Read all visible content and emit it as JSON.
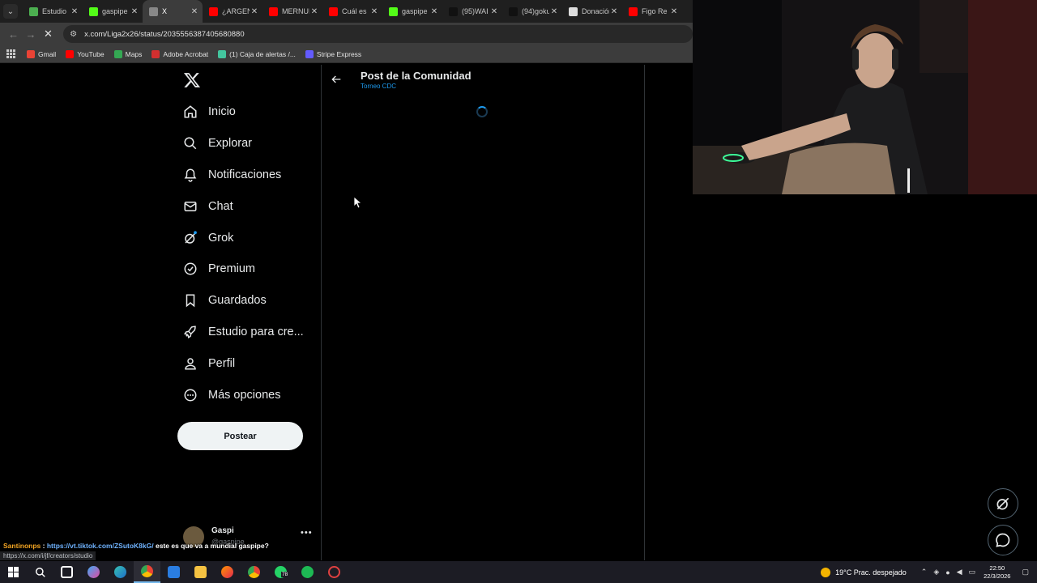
{
  "browser": {
    "tabs": [
      {
        "title": "Estudio",
        "fav_color": "#4caf50",
        "active": false
      },
      {
        "title": "gaspipe",
        "fav_color": "#53fc18",
        "active": false
      },
      {
        "title": "X",
        "fav_color": "#888888",
        "active": true
      },
      {
        "title": "¿ARGENTINA",
        "fav_color": "#ff0000",
        "active": false
      },
      {
        "title": "MERNUI",
        "fav_color": "#ff0000",
        "active": false
      },
      {
        "title": "Cuál es",
        "fav_color": "#ff0000",
        "active": false
      },
      {
        "title": "gaspipe",
        "fav_color": "#53fc18",
        "active": false
      },
      {
        "title": "(95)WAI",
        "fav_color": "#111111",
        "active": false
      },
      {
        "title": "(94)goku",
        "fav_color": "#111111",
        "active": false
      },
      {
        "title": "Donación",
        "fav_color": "#dddddd",
        "active": false
      },
      {
        "title": "Figo Re",
        "fav_color": "#ff0000",
        "active": false
      }
    ],
    "url": "x.com/Liga2x26/status/2035556387405680880",
    "bookmarks": [
      {
        "label": "Gmail",
        "color": "#ea4335"
      },
      {
        "label": "YouTube",
        "color": "#ff0000"
      },
      {
        "label": "Maps",
        "color": "#34a853"
      },
      {
        "label": "Adobe Acrobat",
        "color": "#d32f2f"
      },
      {
        "label": "(1) Caja de alertas /...",
        "color": "#43c59e"
      },
      {
        "label": "Stripe Express",
        "color": "#635bff"
      }
    ]
  },
  "x_app": {
    "nav": [
      {
        "label": "Inicio",
        "icon": "home-icon"
      },
      {
        "label": "Explorar",
        "icon": "search-icon"
      },
      {
        "label": "Notificaciones",
        "icon": "bell-icon"
      },
      {
        "label": "Chat",
        "icon": "mail-icon"
      },
      {
        "label": "Grok",
        "icon": "grok-icon"
      },
      {
        "label": "Premium",
        "icon": "premium-icon"
      },
      {
        "label": "Guardados",
        "icon": "bookmark-icon"
      },
      {
        "label": "Estudio para cre...",
        "icon": "rocket-icon"
      },
      {
        "label": "Perfil",
        "icon": "person-icon"
      },
      {
        "label": "Más opciones",
        "icon": "more-circle-icon"
      }
    ],
    "post_button": "Postear",
    "account": {
      "name": "Gaspi",
      "handle": "@gaspipe"
    },
    "main": {
      "title": "Post de la Comunidad",
      "subtitle": "Torneo CDC"
    },
    "accent": "#1d9bf0"
  },
  "chat": {
    "user": "Santinonps",
    "separator": " : ",
    "link": "https://vt.tiktok.com/ZSutoK8kG/",
    "message": " este es que va a mundial gaspipe?"
  },
  "status_bar_url": "https://x.com/i/jf/creators/studio",
  "taskbar": {
    "weather": "19°C  Prac. despejado",
    "time": "22:50",
    "date": "22/3/2026",
    "whatsapp_badge": "78"
  }
}
